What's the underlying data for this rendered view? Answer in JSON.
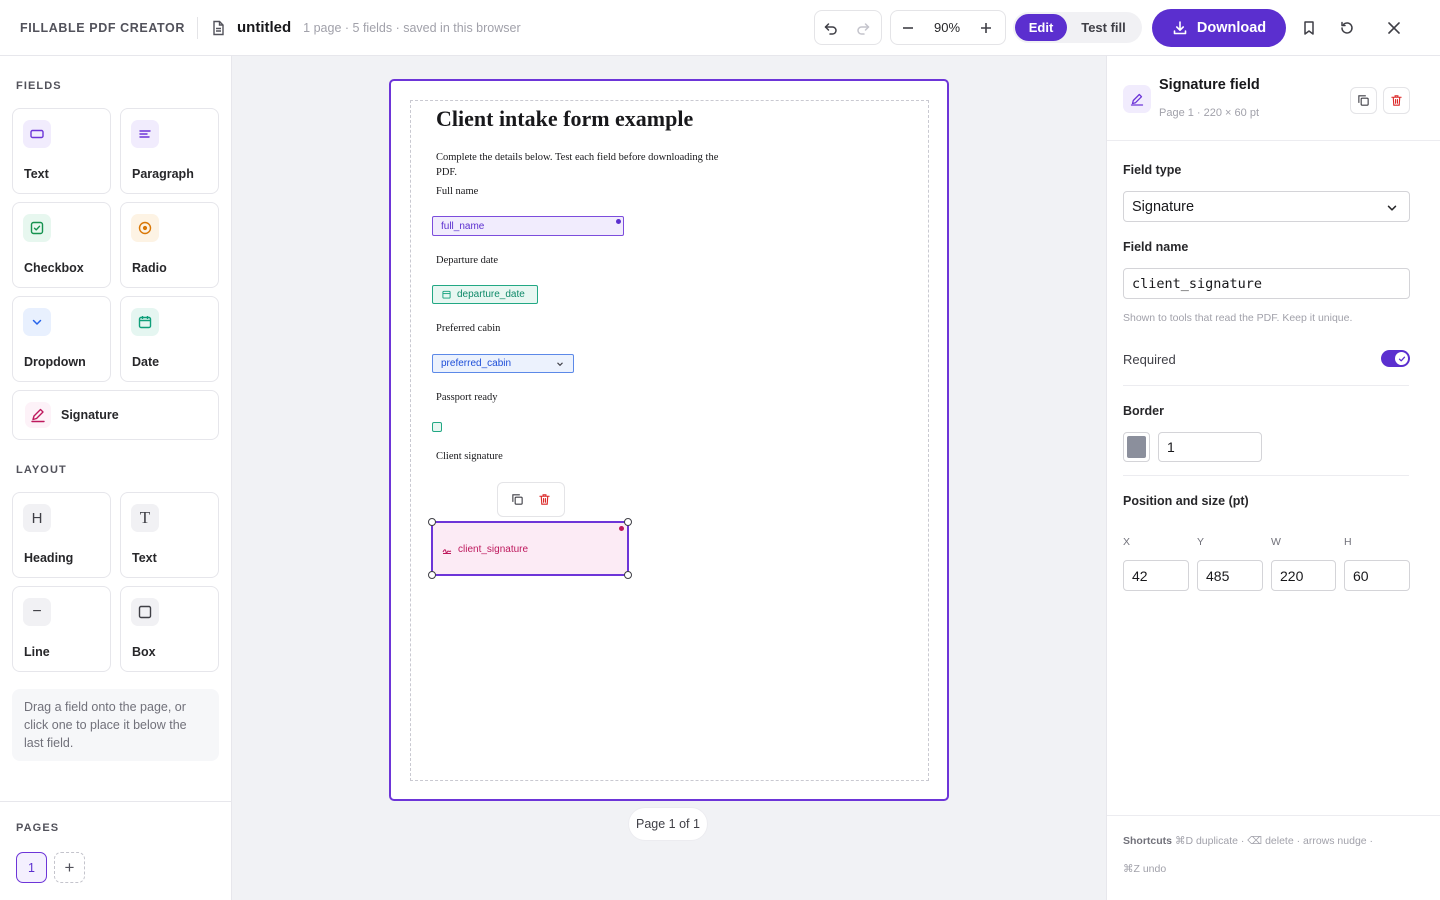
{
  "app": {
    "brand": "FILLABLE PDF CREATOR",
    "doc_name": "untitled",
    "doc_meta": "1 page · 5 fields · saved in this browser"
  },
  "toolbar": {
    "zoom": "90%",
    "mode_edit": "Edit",
    "mode_test": "Test fill",
    "download": "Download",
    "active_mode": "Edit"
  },
  "sidebar": {
    "fields_heading": "FIELDS",
    "fields": [
      {
        "label": "Text",
        "icon": "text-field-icon"
      },
      {
        "label": "Paragraph",
        "icon": "paragraph-icon"
      },
      {
        "label": "Checkbox",
        "icon": "checkbox-icon"
      },
      {
        "label": "Radio",
        "icon": "radio-icon"
      },
      {
        "label": "Dropdown",
        "icon": "chevron-down-icon"
      },
      {
        "label": "Date",
        "icon": "calendar-icon"
      },
      {
        "label": "Signature",
        "icon": "pen-icon"
      }
    ],
    "layout_heading": "LAYOUT",
    "layout": [
      {
        "label": "Heading",
        "glyph": "H"
      },
      {
        "label": "Text",
        "glyph": "T"
      },
      {
        "label": "Line",
        "glyph": "−"
      },
      {
        "label": "Box",
        "glyph": ""
      }
    ],
    "hint": "Drag a field onto the page, or click one to place it below the last field.",
    "pages_heading": "PAGES",
    "pages": [
      "1"
    ],
    "add_page": "+"
  },
  "document": {
    "title": "Client intake form example",
    "intro": "Complete the details below. Test each field before downloading the PDF.",
    "labels": {
      "full_name": "Full name",
      "departure": "Departure date",
      "cabin": "Preferred cabin",
      "passport": "Passport ready",
      "signature": "Client signature"
    },
    "fields": {
      "full_name": "full_name",
      "departure_date": "departure_date",
      "preferred_cabin": "preferred_cabin",
      "client_signature": "client_signature"
    },
    "page_indicator": "Page 1 of 1"
  },
  "inspector": {
    "title": "Signature field",
    "subtitle": "Page 1 · 220 × 60 pt",
    "field_type_label": "Field type",
    "field_type_value": "Signature",
    "field_name_label": "Field name",
    "field_name_value": "client_signature",
    "field_name_help": "Shown to tools that read the PDF. Keep it unique.",
    "required_label": "Required",
    "required": true,
    "border_label": "Border",
    "border_color": "#8b8f9c",
    "border_width": "1",
    "position_label": "Position and size (pt)",
    "x_label": "X",
    "x": "42",
    "y_label": "Y",
    "y": "485",
    "w_label": "W",
    "w": "220",
    "h_label": "H",
    "h": "60",
    "shortcuts_title": "Shortcuts",
    "shortcuts_line1": "⌘D duplicate · ⌫ delete · arrows nudge ·",
    "shortcuts_line2": "⌘Z undo"
  },
  "colors": {
    "accent": "#5b2fcf",
    "selection": "#6d35d8",
    "danger": "#dc2626",
    "date_field": "#0f9f7a",
    "dropdown_field": "#2563eb",
    "signature_field": "#be185d"
  }
}
